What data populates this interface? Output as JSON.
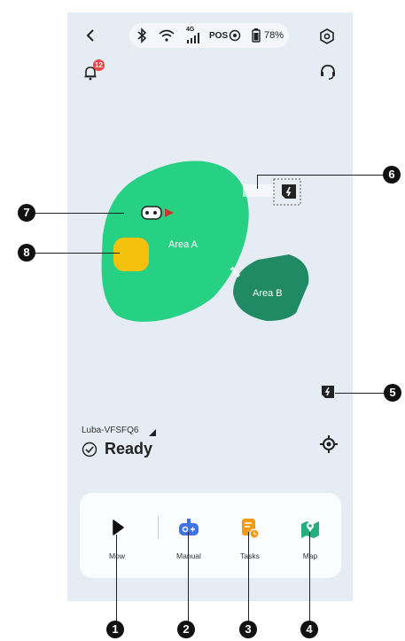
{
  "status_bar": {
    "network": "4G",
    "pos_label": "POS",
    "battery": "78%"
  },
  "notifications": {
    "count": "12"
  },
  "map": {
    "area_a": "Area A",
    "area_b": "Area B"
  },
  "device": {
    "name": "Luba-VFSFQ6",
    "status": "Ready"
  },
  "nav": {
    "mow": "Mow",
    "manual": "Manual",
    "tasks": "Tasks",
    "map": "Map"
  },
  "callouts": [
    "1",
    "2",
    "3",
    "4",
    "5",
    "6",
    "7",
    "8"
  ],
  "colors": {
    "area_a": "#27d184",
    "area_b": "#1f8a64",
    "obstacle": "#f4c20d",
    "tasks_icon": "#f29a12",
    "manual_icon": "#3e73e0",
    "map_icon": "#23b07c"
  }
}
